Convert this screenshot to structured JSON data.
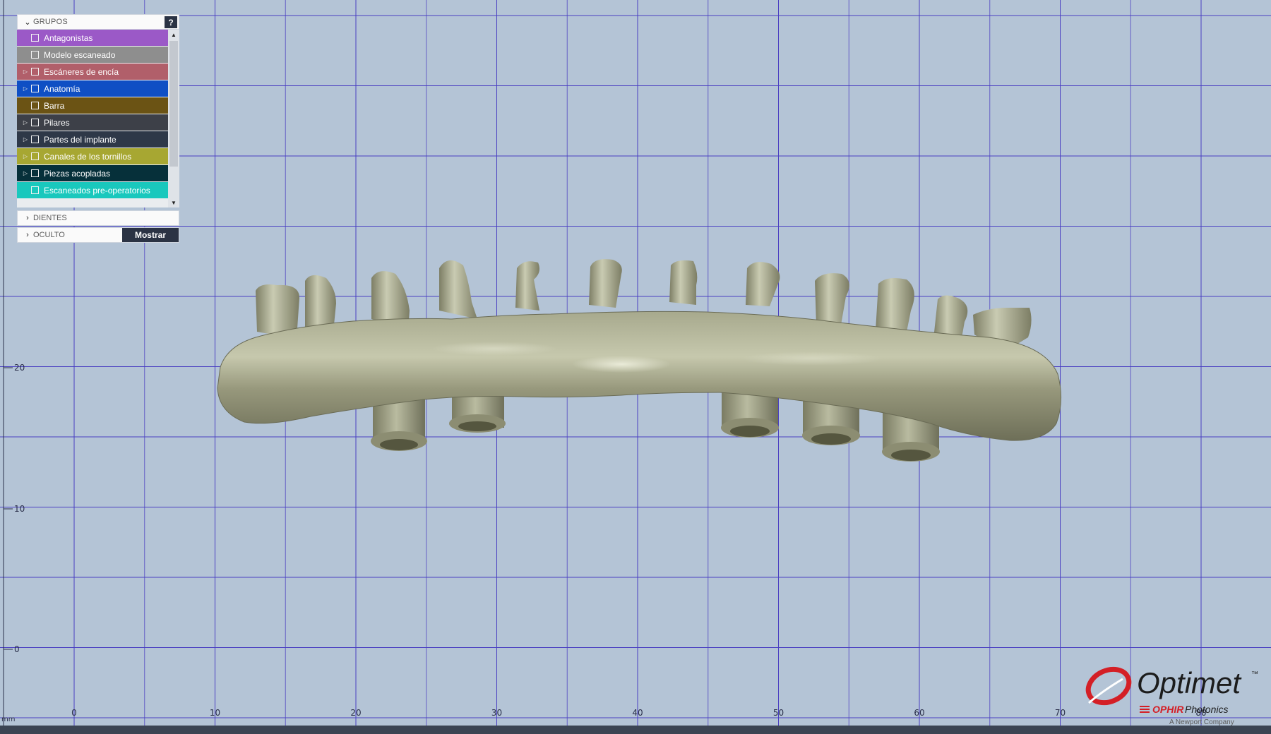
{
  "groups_panel": {
    "header": "GRUPOS",
    "help": "?",
    "items": [
      {
        "label": "Antagonistas",
        "color": "#9b59c7",
        "expandable": false
      },
      {
        "label": "Modelo escaneado",
        "color": "#8e8e8e",
        "expandable": false
      },
      {
        "label": "Escáneres de encía",
        "color": "#b15f6a",
        "expandable": true
      },
      {
        "label": "Anatomía",
        "color": "#0f4fc4",
        "expandable": true
      },
      {
        "label": "Barra",
        "color": "#6b5314",
        "expandable": false
      },
      {
        "label": "Pilares",
        "color": "#3d4048",
        "expandable": true
      },
      {
        "label": "Partes del implante",
        "color": "#2e3848",
        "expandable": true
      },
      {
        "label": "Canales de los tornillos",
        "color": "#a7a732",
        "expandable": true
      },
      {
        "label": "Piezas acopladas",
        "color": "#06303a",
        "expandable": true
      },
      {
        "label": "Escaneados pre-operatorios",
        "color": "#19c8bd",
        "expandable": false
      }
    ],
    "sections": [
      {
        "label": "DIENTES"
      },
      {
        "label": "OCULTO",
        "button": "Mostrar"
      }
    ]
  },
  "axes": {
    "x_ticks": [
      "0",
      "10",
      "20",
      "30",
      "40",
      "50",
      "60",
      "70",
      "80"
    ],
    "y_ticks": [
      "20",
      "10",
      "0"
    ],
    "unit": "mm"
  },
  "model": {
    "color": "#9b9c80",
    "name": "implant-bar"
  },
  "logo": {
    "brand": "Optimet",
    "trademark": "™",
    "company": "OPHIR",
    "company_suffix": "Photonics",
    "tagline": "A Newport Company",
    "accent": "#d41f26"
  },
  "colors": {
    "background": "#b4c4d6",
    "grid": "#4a3fc2"
  }
}
